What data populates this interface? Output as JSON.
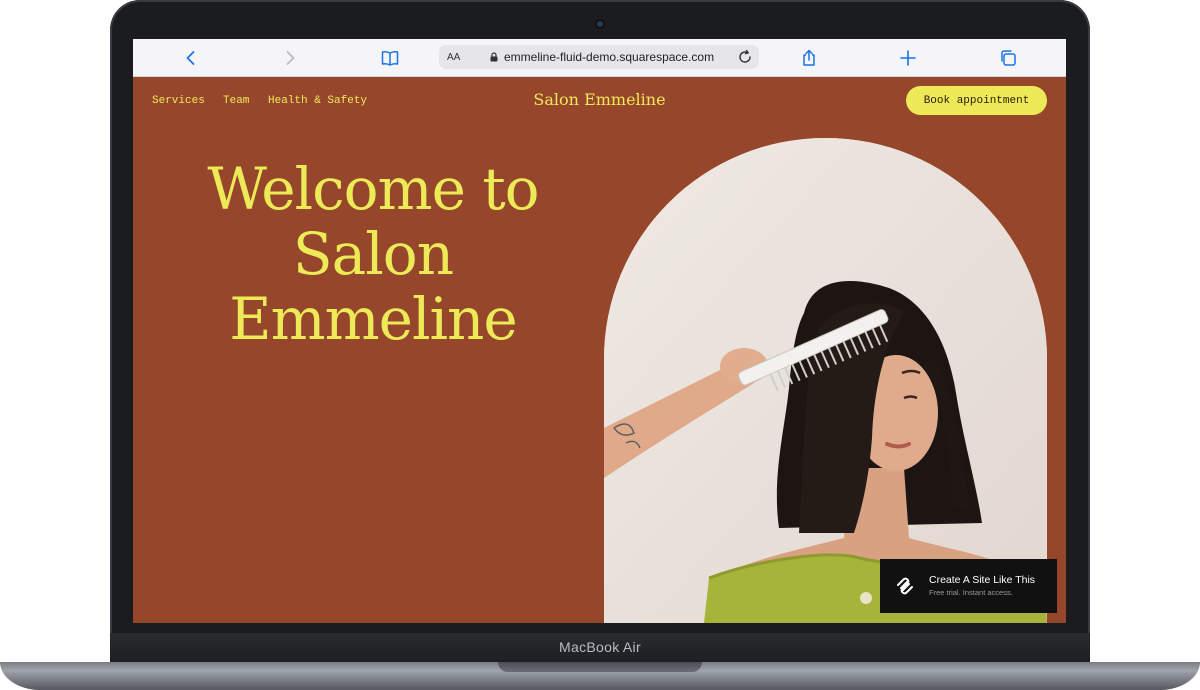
{
  "browser": {
    "url": "emmeline-fluid-demo.squarespace.com",
    "reader_label": "AA",
    "accent_color": "#1a73e8",
    "icons": [
      "back-icon",
      "forward-icon",
      "bookmarks-icon",
      "lock-icon",
      "reload-icon",
      "share-icon",
      "new-tab-icon",
      "tabs-icon"
    ]
  },
  "site": {
    "nav": [
      "Services",
      "Team",
      "Health & Safety"
    ],
    "brand": "Salon Emmeline",
    "cta": "Book appointment",
    "headline": [
      "Welcome to",
      "Salon",
      "Emmeline"
    ],
    "colors": {
      "background": "#96462b",
      "accent": "#edea58"
    }
  },
  "badge": {
    "title": "Create A Site Like This",
    "subtitle": "Free trial. Instant access."
  },
  "device": {
    "label": "MacBook Air"
  }
}
